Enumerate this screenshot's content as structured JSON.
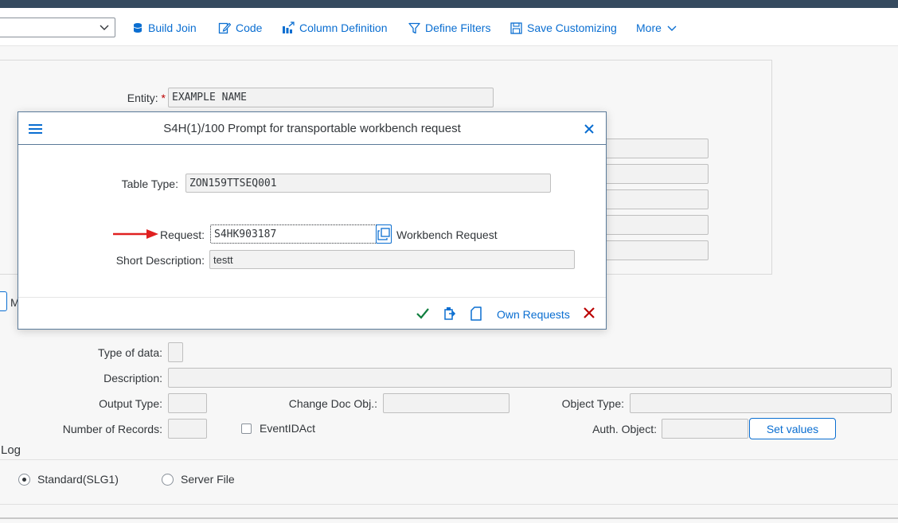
{
  "toolbar": {
    "dropdown_value": "",
    "buttons": {
      "build_join": "Build Join",
      "code": "Code",
      "column_definition": "Column Definition",
      "define_filters": "Define Filters",
      "save_customizing": "Save Customizing",
      "more": "More"
    }
  },
  "background": {
    "entity_label": "Entity:",
    "required_mark": "*",
    "entity_value": "EXAMPLE NAME",
    "partial_label": "M",
    "type_of_data_label": "Type of data:",
    "type_of_data_value": "",
    "description_label": "Description:",
    "description_value": "",
    "output_type_label": "Output Type:",
    "output_type_value": "",
    "change_doc_label": "Change Doc Obj.:",
    "change_doc_value": "",
    "object_type_label": "Object Type:",
    "object_type_value": "",
    "num_records_label": "Number of Records:",
    "num_records_value": "",
    "event_id_label": "EventIDAct",
    "auth_object_label": "Auth. Object:",
    "auth_object_value": "",
    "set_values_label": "Set values",
    "log_label": "Log",
    "log_options": [
      "Standard(SLG1)",
      "Server File"
    ],
    "log_selected": "Standard(SLG1)"
  },
  "dialog": {
    "title": "S4H(1)/100 Prompt for transportable workbench request",
    "table_type_label": "Table Type:",
    "table_type_value": "ZON159TTSEQ001",
    "request_label": "Request:",
    "request_value": "S4HK903187",
    "request_type": "Workbench Request",
    "short_desc_label": "Short Description:",
    "short_desc_value": "testt",
    "own_requests_label": "Own Requests"
  },
  "colors": {
    "shell": "#354a5f",
    "accent": "#0a6ed1",
    "confirm": "#107e3e",
    "cancel": "#bb0000",
    "annotation_arrow": "#e02020"
  }
}
